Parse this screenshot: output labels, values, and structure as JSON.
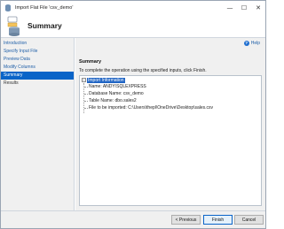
{
  "window": {
    "title": "Import Flat File 'csv_demo'",
    "controls": {
      "minimize": "—",
      "maximize": "☐",
      "close": "✕"
    }
  },
  "header": {
    "title": "Summary"
  },
  "sidebar": {
    "items": [
      {
        "label": "Introduction",
        "state": "link"
      },
      {
        "label": "Specify Input File",
        "state": "link"
      },
      {
        "label": "Preview Data",
        "state": "link"
      },
      {
        "label": "Modify Columns",
        "state": "link"
      },
      {
        "label": "Summary",
        "state": "active"
      },
      {
        "label": "Results",
        "state": "plain"
      }
    ]
  },
  "main": {
    "help_label": "Help",
    "section_title": "Summary",
    "instruction": "To complete the operation using the specified inputs, click Finish.",
    "tree": {
      "toggle": "−",
      "root_label": "Import Information",
      "children": [
        "Name: ANDY\\SQLEXPRESS",
        "Database Name: csv_demo",
        "Table Name: dbo.sales2",
        "File to be imported: C:\\Users\\thepl\\OneDrive\\Desktop\\sales.csv"
      ]
    }
  },
  "footer": {
    "previous": "< Previous",
    "finish": "Finish",
    "cancel": "Cancel"
  },
  "colors": {
    "accent": "#0a64c8",
    "link": "#1f5fa8",
    "panel_bg": "#f0f0f0"
  }
}
